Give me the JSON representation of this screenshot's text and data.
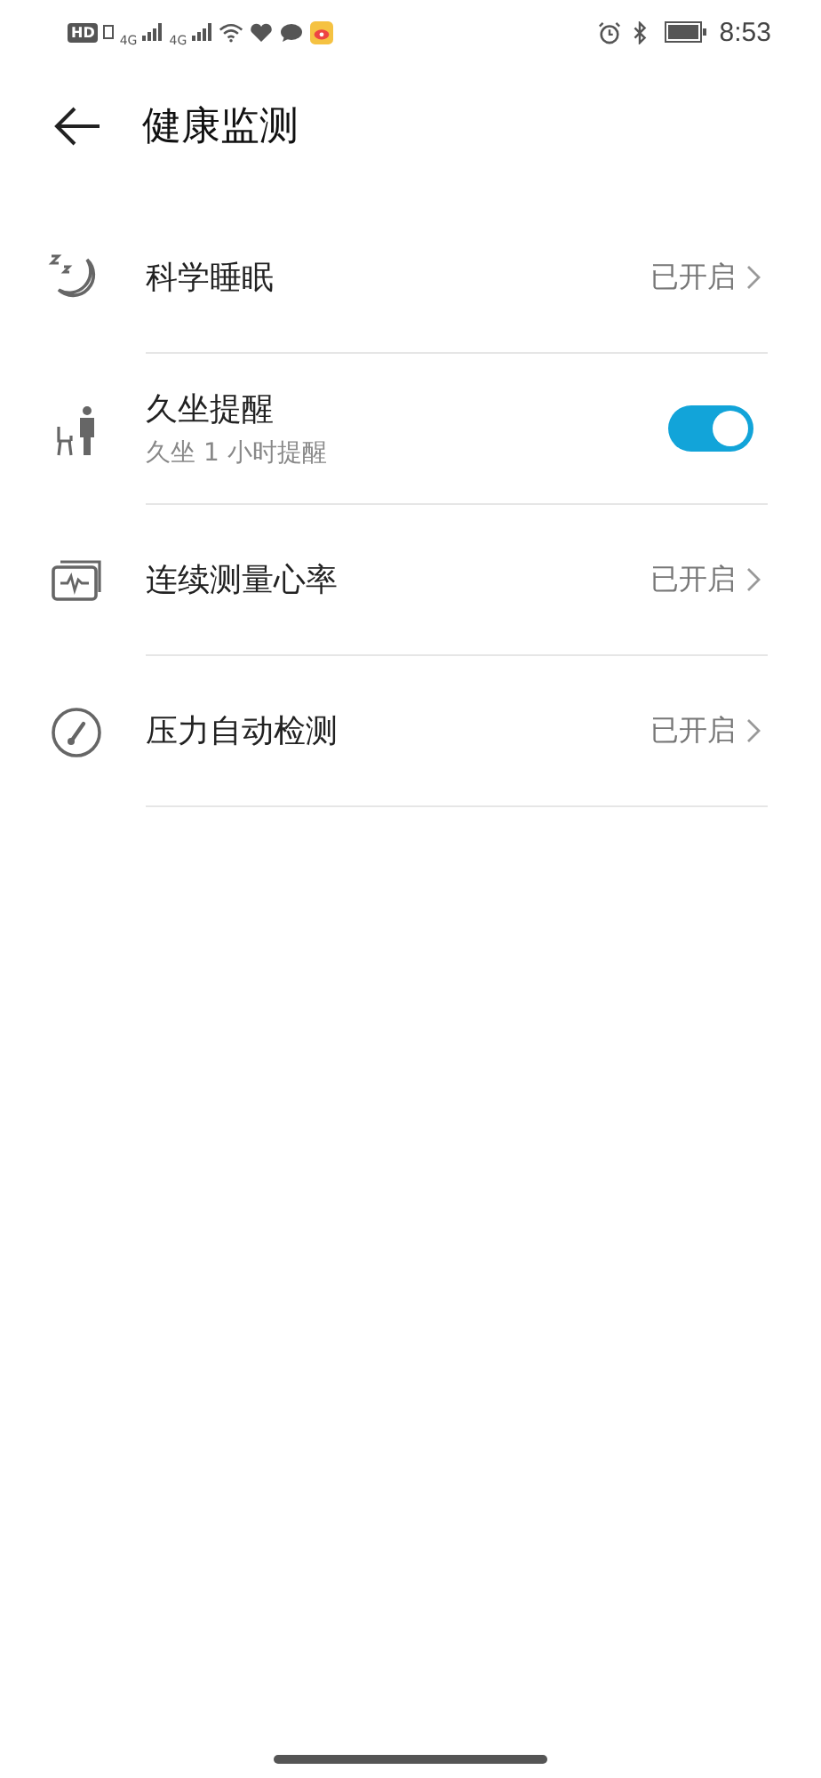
{
  "status_bar": {
    "left": [
      "HD",
      "4G",
      "4G"
    ],
    "time": "8:53"
  },
  "header": {
    "title": "健康监测"
  },
  "items": [
    {
      "kind": "link",
      "title": "科学睡眠",
      "status": "已开启"
    },
    {
      "kind": "toggle",
      "title": "久坐提醒",
      "subtitle": "久坐 1 小时提醒",
      "on": true
    },
    {
      "kind": "link",
      "title": "连续测量心率",
      "status": "已开启"
    },
    {
      "kind": "link",
      "title": "压力自动检测",
      "status": "已开启"
    }
  ]
}
